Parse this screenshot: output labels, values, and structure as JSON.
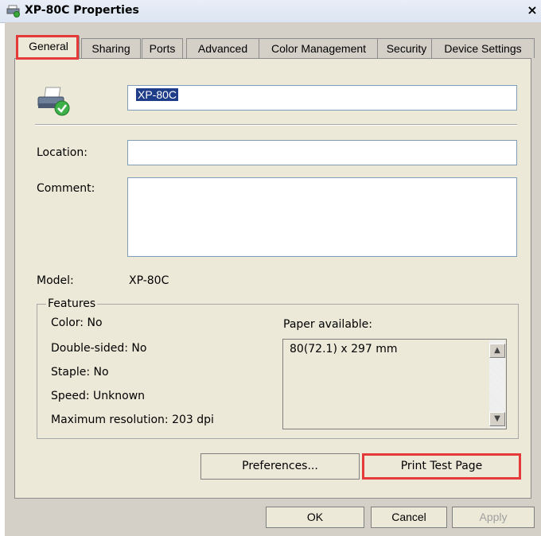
{
  "window": {
    "title": "XP-80C Properties",
    "close_glyph": "×"
  },
  "tabs": [
    {
      "label": "General"
    },
    {
      "label": "Sharing"
    },
    {
      "label": "Ports"
    },
    {
      "label": "Advanced"
    },
    {
      "label": "Color Management"
    },
    {
      "label": "Security"
    },
    {
      "label": "Device Settings"
    }
  ],
  "general": {
    "printer_name": "XP-80C",
    "location_label": "Location:",
    "location_value": "",
    "comment_label": "Comment:",
    "comment_value": "",
    "model_label": "Model:",
    "model_value": "XP-80C"
  },
  "features": {
    "title": "Features",
    "color": "Color: No",
    "double_sided": "Double-sided: No",
    "staple": "Staple: No",
    "speed": "Speed: Unknown",
    "max_resolution": "Maximum resolution: 203 dpi",
    "paper_label": "Paper available:",
    "paper_items": [
      "80(72.1) x 297 mm"
    ]
  },
  "buttons": {
    "preferences": "Preferences...",
    "print_test_page": "Print Test Page",
    "ok": "OK",
    "cancel": "Cancel",
    "apply": "Apply"
  },
  "colors": {
    "highlight": "#e53a3a",
    "selection": "#1f3e8a"
  },
  "icons": {
    "title": "printer-icon",
    "printer": "printer-ready-icon",
    "scroll_up": "scroll-up-arrow-icon",
    "scroll_down": "scroll-down-arrow-icon"
  }
}
